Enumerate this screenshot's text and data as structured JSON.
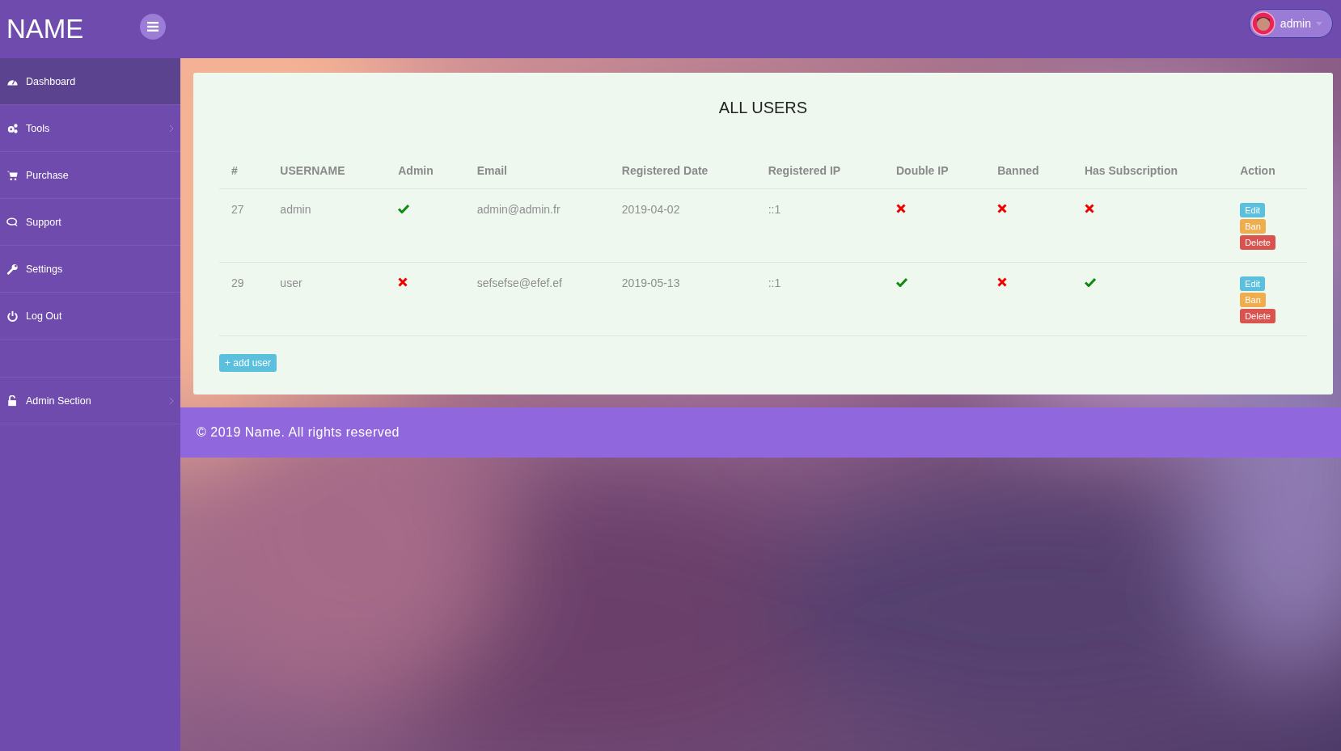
{
  "brand": "NAME",
  "user_menu": {
    "label": "admin"
  },
  "sidebar": {
    "items": [
      {
        "label": "Dashboard",
        "selected": true
      },
      {
        "label": "Tools",
        "selected": false
      },
      {
        "label": "Purchase",
        "selected": false
      },
      {
        "label": "Support",
        "selected": false
      },
      {
        "label": "Settings",
        "selected": false
      },
      {
        "label": "Log Out",
        "selected": false
      },
      {
        "label": "Admin Section",
        "selected": false
      }
    ]
  },
  "card": {
    "title": "ALL USERS",
    "table": {
      "columns": [
        "#",
        "USERNAME",
        "Admin",
        "Email",
        "Registered Date",
        "Registered IP",
        "Double IP",
        "Banned",
        "Has Subscription",
        "Action"
      ],
      "rows": [
        {
          "id": "27",
          "username": "admin",
          "admin": true,
          "email": "admin@admin.fr",
          "date": "2019-04-02",
          "ip": "::1",
          "double_ip": false,
          "banned": false,
          "has_subscription": false,
          "actions": [
            {
              "label": "Edit",
              "kind": "edit"
            },
            {
              "label": "Ban",
              "kind": "ban"
            },
            {
              "label": "Delete",
              "kind": "delete"
            }
          ]
        },
        {
          "id": "29",
          "username": "user",
          "admin": false,
          "email": "sefsefse@efef.ef",
          "date": "2019-05-13",
          "ip": "::1",
          "double_ip": true,
          "banned": false,
          "has_subscription": true,
          "actions": [
            {
              "label": "Edit",
              "kind": "edit"
            },
            {
              "label": "Ban",
              "kind": "ban"
            },
            {
              "label": "Delete",
              "kind": "delete"
            }
          ]
        }
      ]
    },
    "add_button": "+ add user"
  },
  "footer": "© 2019 Name. All rights reserved"
}
